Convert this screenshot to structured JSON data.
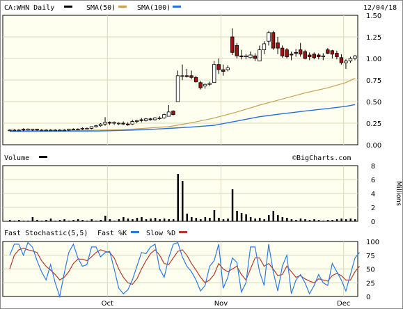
{
  "header": {
    "symbol": "CA:WHN Daily",
    "sma50_label": "SMA(50)",
    "sma100_label": "SMA(100)",
    "date": "12/04/18"
  },
  "volume_panel": {
    "title": "Volume",
    "watermark": "©BigCharts.com",
    "unit_label": "Millions"
  },
  "stoch_panel": {
    "title": "Fast Stochastic(5,5)",
    "fast_label": "Fast %K",
    "slow_label": "Slow %D"
  },
  "x_labels": [
    "Oct",
    "Nov",
    "Dec"
  ],
  "colors": {
    "up": "#ffffff",
    "down": "#a01010",
    "sma50": "#c8a050",
    "sma100": "#2b6fd6",
    "fastk": "#2b78e4",
    "slowd": "#b03a2e",
    "panel_bg": "#fffff0",
    "grid": "#d8d8b8"
  },
  "chart_data": [
    {
      "type": "candlestick",
      "title": "CA:WHN Daily",
      "ylim": [
        0,
        1.5
      ],
      "yticks": [
        "0.00",
        "0.25",
        "0.50",
        "0.75",
        "1.00",
        "1.25",
        "1.50"
      ],
      "candles": [
        {
          "o": 0.17,
          "h": 0.18,
          "l": 0.16,
          "c": 0.17
        },
        {
          "o": 0.17,
          "h": 0.18,
          "l": 0.16,
          "c": 0.17
        },
        {
          "o": 0.17,
          "h": 0.18,
          "l": 0.16,
          "c": 0.17
        },
        {
          "o": 0.18,
          "h": 0.19,
          "l": 0.16,
          "c": 0.17
        },
        {
          "o": 0.17,
          "h": 0.19,
          "l": 0.17,
          "c": 0.18
        },
        {
          "o": 0.17,
          "h": 0.18,
          "l": 0.16,
          "c": 0.18
        },
        {
          "o": 0.18,
          "h": 0.18,
          "l": 0.16,
          "c": 0.17
        },
        {
          "o": 0.17,
          "h": 0.18,
          "l": 0.16,
          "c": 0.17
        },
        {
          "o": 0.17,
          "h": 0.18,
          "l": 0.16,
          "c": 0.17
        },
        {
          "o": 0.17,
          "h": 0.18,
          "l": 0.16,
          "c": 0.17
        },
        {
          "o": 0.17,
          "h": 0.18,
          "l": 0.16,
          "c": 0.17
        },
        {
          "o": 0.17,
          "h": 0.18,
          "l": 0.16,
          "c": 0.17
        },
        {
          "o": 0.17,
          "h": 0.18,
          "l": 0.16,
          "c": 0.17
        },
        {
          "o": 0.17,
          "h": 0.18,
          "l": 0.16,
          "c": 0.18
        },
        {
          "o": 0.18,
          "h": 0.19,
          "l": 0.17,
          "c": 0.18
        },
        {
          "o": 0.18,
          "h": 0.19,
          "l": 0.17,
          "c": 0.18
        },
        {
          "o": 0.18,
          "h": 0.2,
          "l": 0.17,
          "c": 0.19
        },
        {
          "o": 0.19,
          "h": 0.2,
          "l": 0.18,
          "c": 0.19
        },
        {
          "o": 0.19,
          "h": 0.21,
          "l": 0.18,
          "c": 0.21
        },
        {
          "o": 0.21,
          "h": 0.23,
          "l": 0.2,
          "c": 0.22
        },
        {
          "o": 0.22,
          "h": 0.25,
          "l": 0.21,
          "c": 0.24
        },
        {
          "o": 0.24,
          "h": 0.32,
          "l": 0.22,
          "c": 0.26
        },
        {
          "o": 0.26,
          "h": 0.27,
          "l": 0.23,
          "c": 0.25
        },
        {
          "o": 0.25,
          "h": 0.27,
          "l": 0.23,
          "c": 0.26
        },
        {
          "o": 0.25,
          "h": 0.26,
          "l": 0.23,
          "c": 0.25
        },
        {
          "o": 0.25,
          "h": 0.27,
          "l": 0.23,
          "c": 0.24
        },
        {
          "o": 0.24,
          "h": 0.26,
          "l": 0.22,
          "c": 0.23
        },
        {
          "o": 0.24,
          "h": 0.29,
          "l": 0.23,
          "c": 0.27
        },
        {
          "o": 0.27,
          "h": 0.29,
          "l": 0.25,
          "c": 0.28
        },
        {
          "o": 0.29,
          "h": 0.31,
          "l": 0.26,
          "c": 0.28
        },
        {
          "o": 0.28,
          "h": 0.31,
          "l": 0.27,
          "c": 0.3
        },
        {
          "o": 0.3,
          "h": 0.31,
          "l": 0.28,
          "c": 0.29
        },
        {
          "o": 0.29,
          "h": 0.32,
          "l": 0.28,
          "c": 0.31
        },
        {
          "o": 0.31,
          "h": 0.33,
          "l": 0.29,
          "c": 0.31
        },
        {
          "o": 0.31,
          "h": 0.36,
          "l": 0.3,
          "c": 0.35
        },
        {
          "o": 0.33,
          "h": 0.46,
          "l": 0.33,
          "c": 0.38
        },
        {
          "o": 0.39,
          "h": 0.4,
          "l": 0.34,
          "c": 0.35
        },
        {
          "o": 0.5,
          "h": 0.86,
          "l": 0.5,
          "c": 0.8
        },
        {
          "o": 0.8,
          "h": 0.93,
          "l": 0.75,
          "c": 0.8
        },
        {
          "o": 0.8,
          "h": 0.88,
          "l": 0.78,
          "c": 0.79
        },
        {
          "o": 0.8,
          "h": 0.86,
          "l": 0.76,
          "c": 0.78
        },
        {
          "o": 0.78,
          "h": 0.8,
          "l": 0.72,
          "c": 0.73
        },
        {
          "o": 0.72,
          "h": 0.74,
          "l": 0.64,
          "c": 0.66
        },
        {
          "o": 0.68,
          "h": 0.71,
          "l": 0.65,
          "c": 0.7
        },
        {
          "o": 0.7,
          "h": 0.73,
          "l": 0.68,
          "c": 0.71
        },
        {
          "o": 0.72,
          "h": 0.97,
          "l": 0.72,
          "c": 0.93
        },
        {
          "o": 0.93,
          "h": 1.0,
          "l": 0.82,
          "c": 0.87
        },
        {
          "o": 0.87,
          "h": 0.93,
          "l": 0.8,
          "c": 0.85
        },
        {
          "o": 0.87,
          "h": 0.92,
          "l": 0.85,
          "c": 0.89
        },
        {
          "o": 1.25,
          "h": 1.35,
          "l": 1.04,
          "c": 1.07
        },
        {
          "o": 1.15,
          "h": 1.18,
          "l": 1.0,
          "c": 1.03
        },
        {
          "o": 1.03,
          "h": 1.1,
          "l": 0.99,
          "c": 1.02
        },
        {
          "o": 1.02,
          "h": 1.05,
          "l": 0.99,
          "c": 1.03
        },
        {
          "o": 1.01,
          "h": 1.08,
          "l": 1.0,
          "c": 1.04
        },
        {
          "o": 1.03,
          "h": 1.06,
          "l": 0.97,
          "c": 1.0
        },
        {
          "o": 0.97,
          "h": 1.15,
          "l": 0.97,
          "c": 1.1
        },
        {
          "o": 1.1,
          "h": 1.2,
          "l": 1.05,
          "c": 1.17
        },
        {
          "o": 1.2,
          "h": 1.32,
          "l": 1.15,
          "c": 1.3
        },
        {
          "o": 1.3,
          "h": 1.32,
          "l": 1.1,
          "c": 1.12
        },
        {
          "o": 1.18,
          "h": 1.25,
          "l": 1.05,
          "c": 1.12
        },
        {
          "o": 1.12,
          "h": 1.15,
          "l": 1.01,
          "c": 1.03
        },
        {
          "o": 1.1,
          "h": 1.12,
          "l": 1.0,
          "c": 1.02
        },
        {
          "o": 1.05,
          "h": 1.08,
          "l": 0.98,
          "c": 1.04
        },
        {
          "o": 1.07,
          "h": 1.11,
          "l": 1.02,
          "c": 1.06
        },
        {
          "o": 1.1,
          "h": 1.18,
          "l": 1.02,
          "c": 1.05
        },
        {
          "o": 1.08,
          "h": 1.1,
          "l": 0.99,
          "c": 1.0
        },
        {
          "o": 1.04,
          "h": 1.07,
          "l": 0.98,
          "c": 1.02
        },
        {
          "o": 1.05,
          "h": 1.07,
          "l": 0.99,
          "c": 1.01
        },
        {
          "o": 1.04,
          "h": 1.06,
          "l": 0.99,
          "c": 1.02
        },
        {
          "o": 1.02,
          "h": 1.06,
          "l": 0.98,
          "c": 1.03
        },
        {
          "o": 1.1,
          "h": 1.12,
          "l": 1.05,
          "c": 1.06
        },
        {
          "o": 1.09,
          "h": 1.1,
          "l": 1.0,
          "c": 1.05
        },
        {
          "o": 1.06,
          "h": 1.09,
          "l": 0.99,
          "c": 1.02
        },
        {
          "o": 1.01,
          "h": 1.05,
          "l": 0.93,
          "c": 0.95
        },
        {
          "o": 0.95,
          "h": 0.99,
          "l": 0.88,
          "c": 0.97
        },
        {
          "o": 0.97,
          "h": 1.02,
          "l": 0.95,
          "c": 1.0
        },
        {
          "o": 1.0,
          "h": 1.04,
          "l": 0.98,
          "c": 1.03
        }
      ],
      "sma50": [
        [
          0,
          0.16
        ],
        [
          15,
          0.165
        ],
        [
          25,
          0.175
        ],
        [
          35,
          0.21
        ],
        [
          40,
          0.255
        ],
        [
          45,
          0.31
        ],
        [
          50,
          0.38
        ],
        [
          55,
          0.46
        ],
        [
          60,
          0.53
        ],
        [
          65,
          0.6
        ],
        [
          70,
          0.66
        ],
        [
          74,
          0.72
        ],
        [
          76,
          0.77
        ]
      ],
      "sma100": [
        [
          0,
          0.155
        ],
        [
          20,
          0.16
        ],
        [
          30,
          0.175
        ],
        [
          40,
          0.205
        ],
        [
          45,
          0.225
        ],
        [
          50,
          0.275
        ],
        [
          55,
          0.325
        ],
        [
          60,
          0.36
        ],
        [
          65,
          0.39
        ],
        [
          70,
          0.42
        ],
        [
          74,
          0.445
        ],
        [
          76,
          0.465
        ]
      ]
    },
    {
      "type": "bar",
      "title": "Volume",
      "ylabel": "Millions",
      "ylim": [
        0,
        8
      ],
      "yticks": [
        "0",
        "2",
        "4",
        "6",
        "8"
      ],
      "values": [
        0.2,
        0.1,
        0.2,
        0.1,
        0.1,
        0.6,
        0.2,
        0.1,
        0.2,
        0.4,
        0.1,
        0.2,
        0.3,
        0.1,
        0.2,
        0.3,
        0.2,
        0.1,
        0.3,
        0.1,
        0.2,
        0.8,
        0.3,
        0.1,
        0.3,
        0.6,
        0.4,
        0.3,
        0.5,
        0.6,
        0.3,
        0.4,
        0.5,
        0.3,
        0.4,
        0.3,
        0.3,
        6.8,
        5.8,
        1.1,
        0.6,
        0.5,
        0.3,
        0.6,
        0.5,
        1.6,
        0.5,
        0.3,
        0.4,
        4.6,
        1.5,
        1.2,
        1.0,
        0.6,
        0.4,
        0.5,
        0.3,
        0.9,
        1.5,
        0.9,
        0.6,
        0.5,
        0.3,
        0.2,
        0.4,
        0.3,
        0.2,
        0.3,
        0.2,
        0.1,
        0.2,
        0.2,
        0.3,
        0.4,
        0.3,
        0.4,
        0.3
      ]
    },
    {
      "type": "line",
      "title": "Fast Stochastic(5,5)",
      "ylim": [
        0,
        100
      ],
      "yticks": [
        "0",
        "25",
        "50",
        "75",
        "100"
      ],
      "series": [
        {
          "name": "Fast %K",
          "values": [
            75,
            95,
            95,
            75,
            98,
            90,
            65,
            45,
            30,
            58,
            25,
            0,
            42,
            80,
            95,
            70,
            55,
            58,
            90,
            90,
            72,
            80,
            82,
            50,
            15,
            5,
            12,
            30,
            55,
            80,
            78,
            90,
            95,
            50,
            35,
            70,
            95,
            98,
            72,
            55,
            45,
            30,
            10,
            20,
            55,
            65,
            95,
            15,
            35,
            70,
            62,
            8,
            25,
            90,
            90,
            45,
            20,
            95,
            45,
            10,
            55,
            75,
            5,
            30,
            40,
            25,
            5,
            20,
            40,
            25,
            20,
            60,
            45,
            30,
            10,
            40,
            70,
            80
          ]
        },
        {
          "name": "Slow %D",
          "values": [
            50,
            75,
            85,
            88,
            85,
            83,
            80,
            65,
            55,
            48,
            40,
            30,
            35,
            45,
            60,
            68,
            68,
            65,
            72,
            80,
            85,
            82,
            80,
            70,
            50,
            35,
            25,
            22,
            32,
            50,
            65,
            78,
            85,
            75,
            60,
            58,
            70,
            82,
            85,
            75,
            60,
            48,
            35,
            25,
            30,
            40,
            60,
            50,
            45,
            50,
            55,
            40,
            30,
            50,
            70,
            70,
            55,
            60,
            50,
            38,
            40,
            55,
            45,
            35,
            38,
            32,
            28,
            25,
            32,
            30,
            28,
            38,
            42,
            38,
            30,
            30,
            45,
            55
          ]
        }
      ]
    }
  ]
}
